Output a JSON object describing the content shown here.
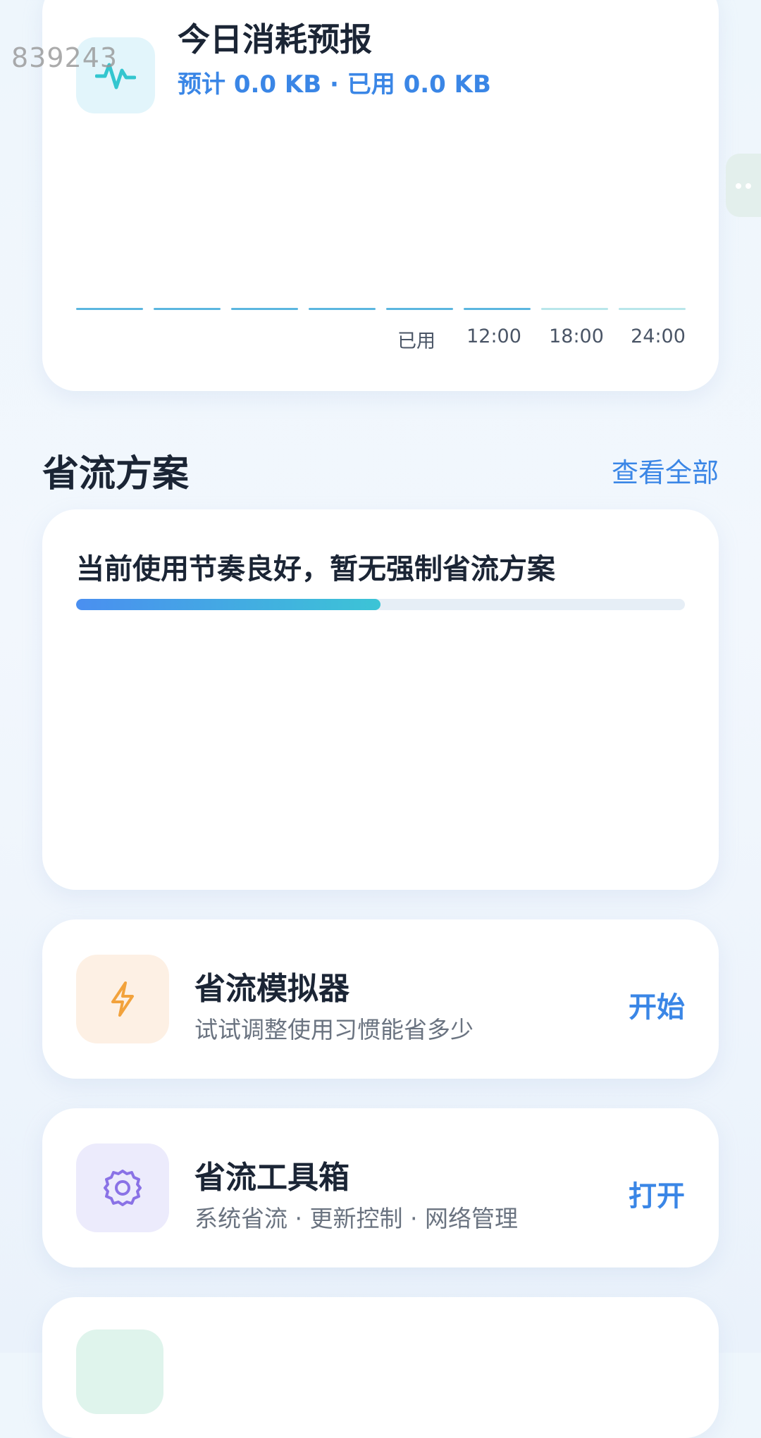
{
  "watermark": "839243",
  "forecast": {
    "title": "今日消耗预报",
    "subtitle": "预计 0.0 KB · 已用 0.0 KB",
    "icon": "pulse-icon",
    "segment_color_active": "#5bb6e0",
    "segment_color_future": "#b8e6ea",
    "ticks": [
      "已用",
      "12:00",
      "18:00",
      "24:00"
    ]
  },
  "section": {
    "title": "省流方案",
    "view_all": "查看全部"
  },
  "plan": {
    "text": "当前使用节奏良好，暂无强制省流方案",
    "progress": 0.5
  },
  "tools": [
    {
      "title": "省流模拟器",
      "desc": "试试调整使用习惯能省多少",
      "action": "开始",
      "icon": "lightning-icon",
      "icon_bg": "#fdf0e4",
      "icon_color": "#f2a23c"
    },
    {
      "title": "省流工具箱",
      "desc": "系统省流 · 更新控制 · 网络管理",
      "action": "打开",
      "icon": "gear-icon",
      "icon_bg": "#ecebfc",
      "icon_color": "#8a72e6"
    }
  ],
  "next_card_icon_bg": "#dff4ec"
}
